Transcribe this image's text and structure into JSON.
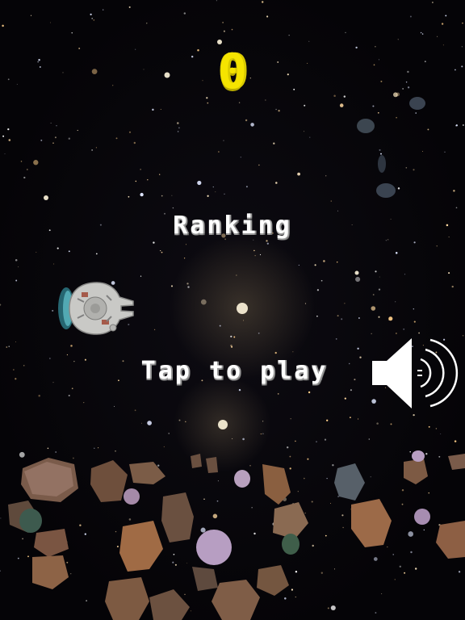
{
  "game": {
    "score": "0",
    "ranking_label": "Ranking",
    "play_prompt": "Tap to play"
  },
  "icons": {
    "sound": "speaker-sound-on-icon",
    "player": "spaceship-icon"
  },
  "colors": {
    "score": "#f5e400",
    "text": "#ffffff",
    "background": "#050408"
  }
}
